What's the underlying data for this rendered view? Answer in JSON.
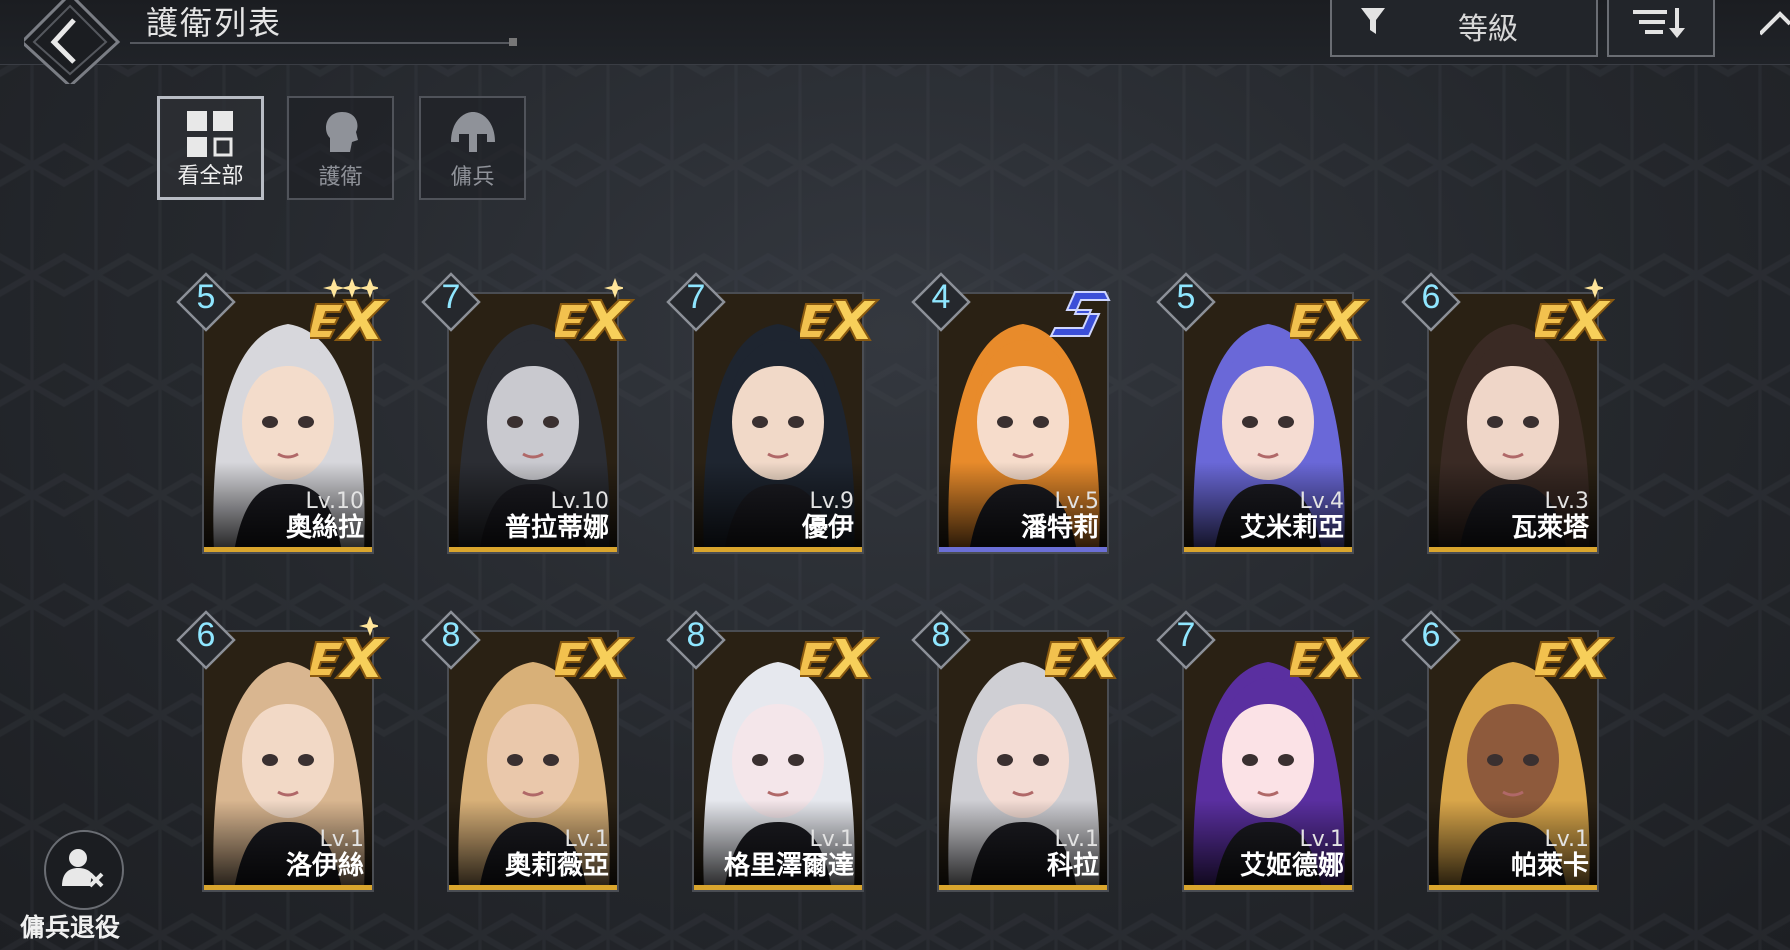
{
  "header": {
    "title": "護衛列表",
    "sort_label": "等級"
  },
  "tabs": [
    {
      "label": "看全部",
      "active": true,
      "icon": "grid-icon"
    },
    {
      "label": "護衛",
      "active": false,
      "icon": "head-icon"
    },
    {
      "label": "傭兵",
      "active": false,
      "icon": "helmet-icon"
    }
  ],
  "cards": [
    {
      "star": "5",
      "level": "Lv.10",
      "name": "奧絲拉",
      "rank": "EX",
      "stars": 3,
      "hair": "#d7d7dc",
      "skin": "#f3dccb"
    },
    {
      "star": "7",
      "level": "Lv.10",
      "name": "普拉蒂娜",
      "rank": "EX",
      "stars": 1,
      "hair": "#2b2d33",
      "skin": "#c9c9cf"
    },
    {
      "star": "7",
      "level": "Lv.9",
      "name": "優伊",
      "rank": "EX",
      "stars": 0,
      "hair": "#1e2530",
      "skin": "#f1d9c8"
    },
    {
      "star": "4",
      "level": "Lv.5",
      "name": "潘特莉",
      "rank": "S",
      "stars": 0,
      "hair": "#e88b2b",
      "skin": "#f6dccb"
    },
    {
      "star": "5",
      "level": "Lv.4",
      "name": "艾米莉亞",
      "rank": "EX",
      "stars": 0,
      "hair": "#6a68d8",
      "skin": "#f5dcd2"
    },
    {
      "star": "6",
      "level": "Lv.3",
      "name": "瓦萊塔",
      "rank": "EX",
      "stars": 1,
      "hair": "#3a2a24",
      "skin": "#efd6c8"
    },
    {
      "star": "6",
      "level": "Lv.1",
      "name": "洛伊絲",
      "rank": "EX",
      "stars": 1,
      "hair": "#d9b690",
      "skin": "#f2d9c6"
    },
    {
      "star": "8",
      "level": "Lv.1",
      "name": "奧莉薇亞",
      "rank": "EX",
      "stars": 0,
      "hair": "#d8b078",
      "skin": "#eac8ab"
    },
    {
      "star": "8",
      "level": "Lv.1",
      "name": "格里澤爾達",
      "rank": "EX",
      "stars": 0,
      "hair": "#e6e8ee",
      "skin": "#f4e6ea"
    },
    {
      "star": "8",
      "level": "Lv.1",
      "name": "科拉",
      "rank": "EX",
      "stars": 0,
      "hair": "#cfcfd4",
      "skin": "#f3dcd4"
    },
    {
      "star": "7",
      "level": "Lv.1",
      "name": "艾姬德娜",
      "rank": "EX",
      "stars": 0,
      "hair": "#5a2fa0",
      "skin": "#fbe2e6"
    },
    {
      "star": "6",
      "level": "Lv.1",
      "name": "帕萊卡",
      "rank": "EX",
      "stars": 0,
      "hair": "#d9a64a",
      "skin": "#8e5a3c"
    }
  ],
  "retire": {
    "label": "傭兵退役"
  },
  "colors": {
    "accent_gold": "#d9a52d",
    "rank_s_blue": "#3b4fd8",
    "star_cyan": "#8fe6ff"
  }
}
